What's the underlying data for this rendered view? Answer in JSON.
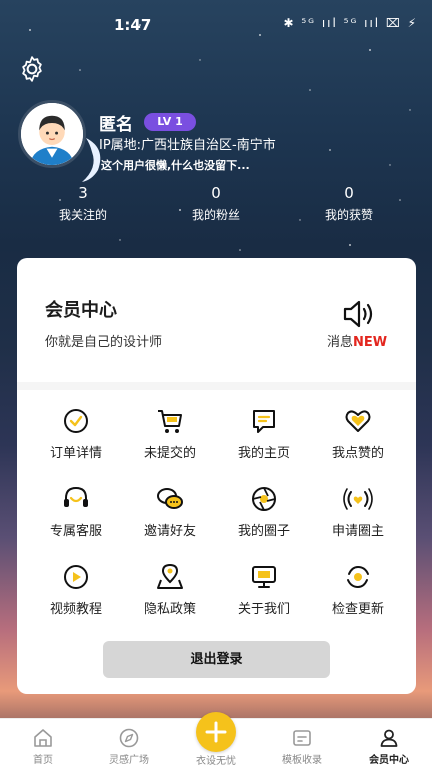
{
  "status_bar": {
    "time": "1:47",
    "indicators": "✱ ⁵ᴳ ııl ⁵ᴳ ııl ⌧ ⚡"
  },
  "profile": {
    "name": "匿名",
    "level": "LV 1",
    "ip_location": "IP属地:广西壮族自治区-南宁市",
    "bio": "这个用户很懒,什么也没留下..."
  },
  "stats": [
    {
      "value": "3",
      "label": "我关注的"
    },
    {
      "value": "0",
      "label": "我的粉丝"
    },
    {
      "value": "0",
      "label": "我的获赞"
    }
  ],
  "member": {
    "title": "会员中心",
    "subtitle": "你就是自己的设计师",
    "message_label": "消息",
    "message_badge": "NEW"
  },
  "menu": [
    {
      "label": "订单详情",
      "icon": "order-check-icon"
    },
    {
      "label": "未提交的",
      "icon": "cart-icon"
    },
    {
      "label": "我的主页",
      "icon": "homepage-icon"
    },
    {
      "label": "我点赞的",
      "icon": "heart-icon"
    },
    {
      "label": "专属客服",
      "icon": "headset-icon"
    },
    {
      "label": "邀请好友",
      "icon": "chat-bubbles-icon"
    },
    {
      "label": "我的圈子",
      "icon": "aperture-icon"
    },
    {
      "label": "申请圈主",
      "icon": "broadcast-heart-icon"
    },
    {
      "label": "视频教程",
      "icon": "play-icon"
    },
    {
      "label": "隐私政策",
      "icon": "map-pin-icon"
    },
    {
      "label": "关于我们",
      "icon": "monitor-icon"
    },
    {
      "label": "检查更新",
      "icon": "refresh-dot-icon"
    }
  ],
  "logout_label": "退出登录",
  "tabs": [
    {
      "label": "首页",
      "icon": "home-icon"
    },
    {
      "label": "灵感广场",
      "icon": "compass-icon"
    },
    {
      "label": "衣设无忧",
      "icon": "plus-icon"
    },
    {
      "label": "模板收录",
      "icon": "template-icon"
    },
    {
      "label": "会员中心",
      "icon": "user-icon"
    }
  ],
  "colors": {
    "accent": "#f5c21b",
    "level_badge": "#7a4fe0",
    "new_badge": "#e3261e"
  }
}
